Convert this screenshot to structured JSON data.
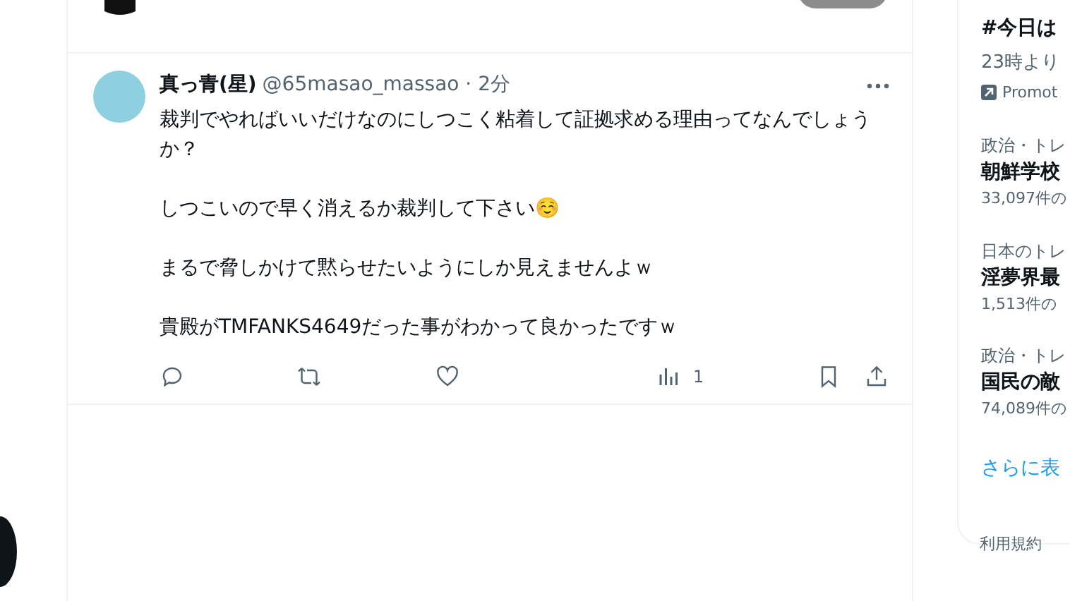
{
  "tweet": {
    "author": "真っ青(星)",
    "meta": "@65masao_massao · 2分",
    "paragraphs": [
      "裁判でやればいいだけなのにしつこく粘着して証拠求める理由ってなんでしょうか？",
      "しつこいので早く消えるか裁判して下さい☺️",
      "まるで脅しかけて黙らせたいようにしか見えませんよｗ",
      "貴殿がTMFANKS4649だった事がわかって良かったですｗ"
    ],
    "views": "1"
  },
  "sidebar": {
    "promoted": {
      "title": "#今日は",
      "subtitle": "23時より",
      "label": "Promot"
    },
    "trends": [
      {
        "context": "政治・トレ",
        "title": "朝鮮学校",
        "count": "33,097件の"
      },
      {
        "context": "日本のトレ",
        "title": "淫夢界最",
        "count": "1,513件の"
      },
      {
        "context": "政治・トレ",
        "title": "国民の敵",
        "count": "74,089件の"
      }
    ],
    "show_more": "さらに表",
    "footer_link": "利用規約"
  }
}
